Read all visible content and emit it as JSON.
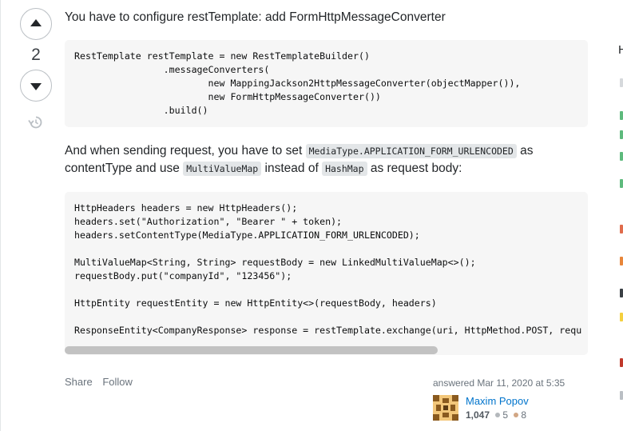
{
  "vote": {
    "count": "2"
  },
  "post": {
    "intro_text": "You have to configure restTemplate: add FormHttpMessageConverter",
    "code_block_1": "RestTemplate restTemplate = new RestTemplateBuilder()\n                .messageConverters(\n                        new MappingJackson2HttpMessageConverter(objectMapper()),\n                        new FormHttpMessageConverter())\n                .build()",
    "para2": {
      "part1": "And when sending request, you have to set ",
      "code1": "MediaType.APPLICATION_FORM_URLENCODED",
      "part2": " as contentType and use ",
      "code2": "MultiValueMap",
      "part3": " instead of ",
      "code3": "HashMap",
      "part4": " as request body:"
    },
    "code_block_2": "HttpHeaders headers = new HttpHeaders();\nheaders.set(\"Authorization\", \"Bearer \" + token);\nheaders.setContentType(MediaType.APPLICATION_FORM_URLENCODED);\n\nMultiValueMap<String, String> requestBody = new LinkedMultiValueMap<>();\nrequestBody.put(\"companyId\", \"123456\");\n\nHttpEntity requestEntity = new HttpEntity<>(requestBody, headers)\n\nResponseEntity<CompanyResponse> response = restTemplate.exchange(uri, HttpMethod.POST, requ"
  },
  "actions": {
    "share": "Share",
    "follow": "Follow"
  },
  "user": {
    "answered": "answered Mar 11, 2020 at 5:35",
    "name": "Maxim Popov",
    "reputation": "1,047",
    "silver": "5",
    "bronze": "8"
  },
  "sidebar_edge": {
    "letter": "H"
  },
  "colors": {
    "link": "#0074cc",
    "code_bg": "#f6f6f6",
    "inline_code_bg": "#e3e6e8"
  }
}
